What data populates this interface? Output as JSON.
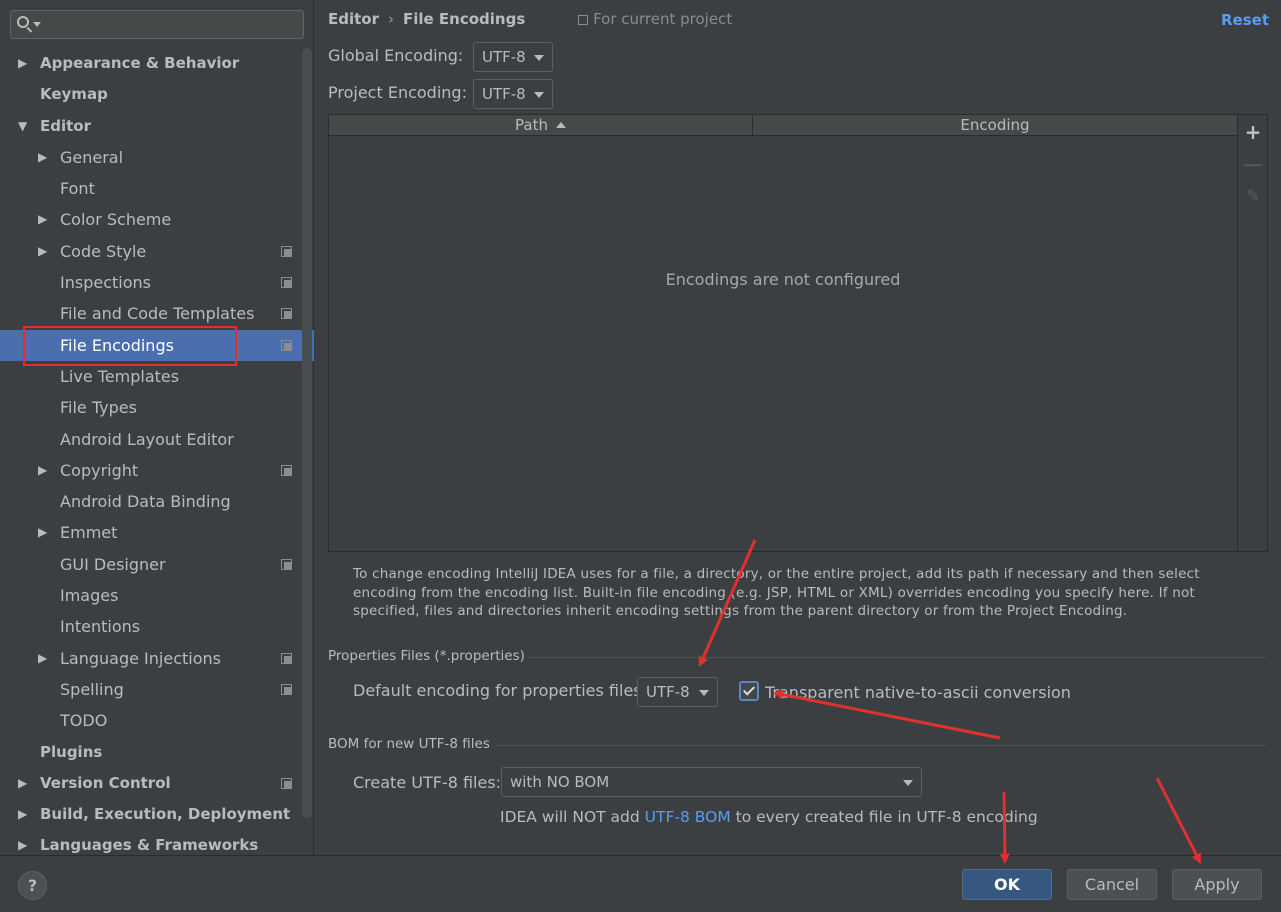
{
  "sidebar": {
    "search": {
      "value": "",
      "placeholder": ""
    },
    "tree": [
      {
        "label": "Appearance & Behavior",
        "level": 0,
        "arrow": "right",
        "bold": true
      },
      {
        "label": "Keymap",
        "level": 0,
        "arrow": "",
        "bold": true
      },
      {
        "label": "Editor",
        "level": 0,
        "arrow": "down",
        "bold": true
      },
      {
        "label": "General",
        "level": 1,
        "arrow": "right"
      },
      {
        "label": "Font",
        "level": 1,
        "arrow": ""
      },
      {
        "label": "Color Scheme",
        "level": 1,
        "arrow": "right"
      },
      {
        "label": "Code Style",
        "level": 1,
        "arrow": "right",
        "project_icon": true
      },
      {
        "label": "Inspections",
        "level": 1,
        "arrow": "",
        "project_icon": true
      },
      {
        "label": "File and Code Templates",
        "level": 1,
        "arrow": "",
        "project_icon": true
      },
      {
        "label": "File Encodings",
        "level": 1,
        "arrow": "",
        "project_icon": true,
        "selected": true
      },
      {
        "label": "Live Templates",
        "level": 1,
        "arrow": ""
      },
      {
        "label": "File Types",
        "level": 1,
        "arrow": ""
      },
      {
        "label": "Android Layout Editor",
        "level": 1,
        "arrow": ""
      },
      {
        "label": "Copyright",
        "level": 1,
        "arrow": "right",
        "project_icon": true
      },
      {
        "label": "Android Data Binding",
        "level": 1,
        "arrow": ""
      },
      {
        "label": "Emmet",
        "level": 1,
        "arrow": "right"
      },
      {
        "label": "GUI Designer",
        "level": 1,
        "arrow": "",
        "project_icon": true
      },
      {
        "label": "Images",
        "level": 1,
        "arrow": ""
      },
      {
        "label": "Intentions",
        "level": 1,
        "arrow": ""
      },
      {
        "label": "Language Injections",
        "level": 1,
        "arrow": "right",
        "project_icon": true
      },
      {
        "label": "Spelling",
        "level": 1,
        "arrow": "",
        "project_icon": true
      },
      {
        "label": "TODO",
        "level": 1,
        "arrow": ""
      },
      {
        "label": "Plugins",
        "level": 0,
        "arrow": "",
        "bold": true
      },
      {
        "label": "Version Control",
        "level": 0,
        "arrow": "right",
        "bold": true,
        "project_icon": true
      },
      {
        "label": "Build, Execution, Deployment",
        "level": 0,
        "arrow": "right",
        "bold": true
      },
      {
        "label": "Languages & Frameworks",
        "level": 0,
        "arrow": "right",
        "bold": true
      }
    ]
  },
  "header": {
    "crumb_parent": "Editor",
    "crumb_separator": "›",
    "crumb_current": "File Encodings",
    "scope": "For current project",
    "reset": "Reset"
  },
  "encodings": {
    "global_label": "Global Encoding:",
    "global_value": "UTF-8",
    "project_label": "Project Encoding:",
    "project_value": "UTF-8",
    "table": {
      "col_path": "Path",
      "col_encoding": "Encoding",
      "empty_text": "Encodings are not configured"
    },
    "help_text": "To change encoding IntelliJ IDEA uses for a file, a directory, or the entire project, add its path if necessary and then select encoding from the encoding list. Built-in file encoding (e.g. JSP, HTML or XML) overrides encoding you specify here. If not specified, files and directories inherit encoding settings from the parent directory or from the Project Encoding."
  },
  "properties": {
    "section_title": "Properties Files (*.properties)",
    "default_label": "Default encoding for properties files:",
    "default_value": "UTF-8",
    "transparent_label": "Transparent native-to-ascii conversion",
    "transparent_checked": true
  },
  "bom": {
    "section_title": "BOM for new UTF-8 files",
    "create_label": "Create UTF-8 files:",
    "create_value": "with NO BOM",
    "note_prefix": "IDEA will NOT add ",
    "note_link": "UTF-8 BOM",
    "note_suffix": " to every created file in UTF-8 encoding"
  },
  "footer": {
    "help": "?",
    "ok": "OK",
    "cancel": "Cancel",
    "apply": "Apply"
  },
  "colors": {
    "background": "#3c3f41",
    "selection": "#4b6eaf",
    "link": "#589df6",
    "default_button": "#365880",
    "annotation": "#e03030"
  },
  "icons": [
    "search-icon",
    "chevron-right-icon",
    "chevron-down-icon",
    "project-scope-icon",
    "add-icon",
    "remove-icon",
    "edit-icon",
    "checkbox-check-icon",
    "help-icon"
  ]
}
